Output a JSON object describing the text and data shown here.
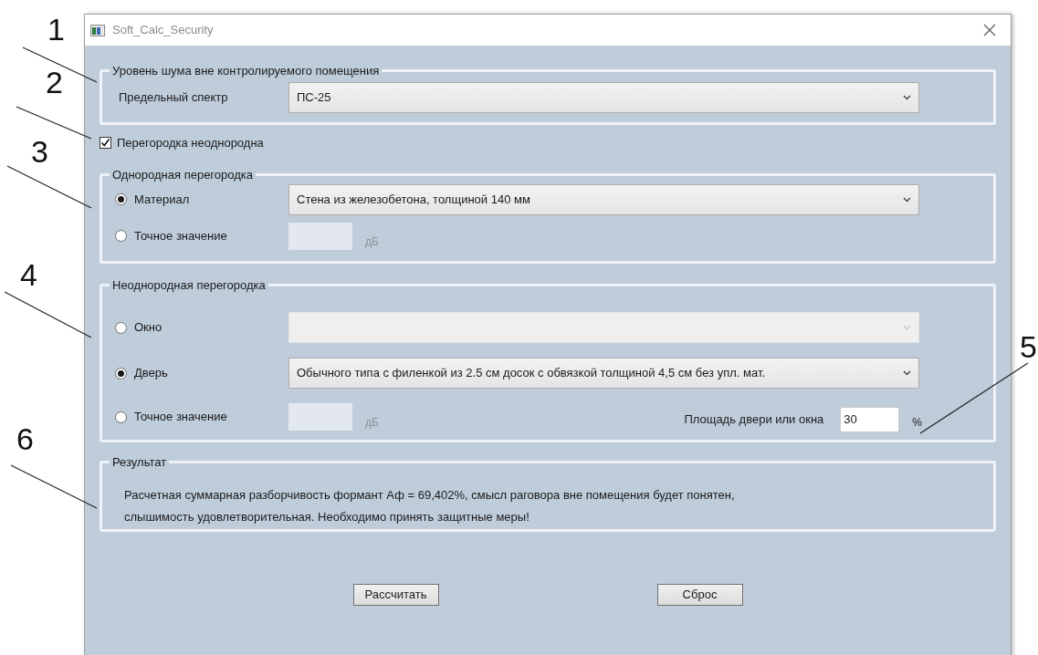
{
  "window": {
    "title": "Soft_Calc_Security"
  },
  "noise_group": {
    "title": "Уровень шума вне контролируемого помещения",
    "spectrum": {
      "label": "Предельный спектр",
      "value": "ПС-25"
    }
  },
  "heterogeneous_checkbox": {
    "label": "Перегородка неоднородна",
    "checked": true
  },
  "homogeneous_group": {
    "title": "Однородная перегородка",
    "options": [
      {
        "kind": "select",
        "label": "Материал",
        "selected": true,
        "disabled": false,
        "value": "Стена из железобетона, толщиной 140 мм"
      },
      {
        "kind": "exact",
        "label": "Точное значение",
        "selected": false,
        "unit": "дБ"
      }
    ]
  },
  "heterogeneous_group": {
    "title": "Неоднородная перегородка",
    "options": [
      {
        "kind": "select",
        "label": "Окно",
        "selected": false,
        "disabled": true
      },
      {
        "kind": "select",
        "label": "Дверь",
        "selected": true,
        "disabled": false,
        "value": "Обычного типа с филенкой из 2.5 см досок с обвязкой толщиной 4,5 см без упл. мат."
      },
      {
        "kind": "exact",
        "label": "Точное значение",
        "selected": false,
        "unit": "дБ"
      }
    ],
    "area": {
      "label": "Площадь двери или окна",
      "value": "30",
      "unit": "%"
    }
  },
  "result": {
    "title": "Результат",
    "lines": [
      "Расчетная суммарная разборчивость формант Аф = 69,402%, смысл раговора вне помещения будет понятен,",
      "слышимость удовлетворительная. Необходимо принять защитные меры!"
    ]
  },
  "buttons": [
    "Рассчитать",
    "Сброс"
  ],
  "callouts": [
    "1",
    "2",
    "3",
    "4",
    "5",
    "6"
  ]
}
